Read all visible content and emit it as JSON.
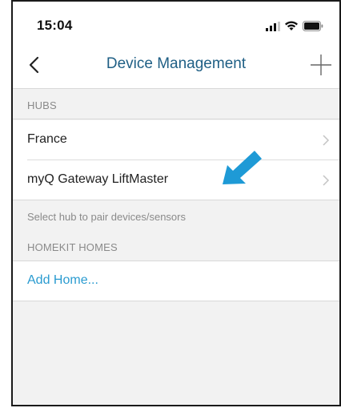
{
  "status_bar": {
    "time": "15:04",
    "icons": [
      "signal-icon",
      "wifi-icon",
      "battery-icon"
    ]
  },
  "nav": {
    "title": "Device Management",
    "back_icon": "chevron-left-icon",
    "add_icon": "plus-icon"
  },
  "hubs": {
    "header": "HUBS",
    "items": [
      {
        "label": "France"
      },
      {
        "label": "myQ Gateway LiftMaster"
      }
    ],
    "footer": "Select hub to pair devices/sensors"
  },
  "homekit": {
    "header": "HOMEKIT HOMES",
    "add_label": "Add Home..."
  },
  "colors": {
    "title": "#1f5f85",
    "link": "#2a9bd0",
    "arrow": "#1e9ad6",
    "background": "#f2f2f2"
  }
}
